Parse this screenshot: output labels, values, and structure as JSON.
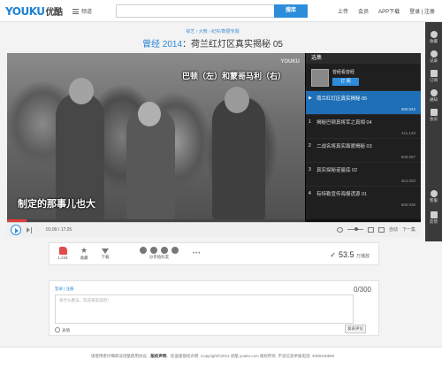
{
  "header": {
    "logo_en": "YOUKU",
    "logo_cn": "优酷",
    "channel_label": "频道",
    "search_value": "",
    "search_button": "搜库",
    "links": [
      "上传",
      "会员",
      "APP下载",
      "登录 | 注册"
    ]
  },
  "sidebar": {
    "items": [
      "收藏",
      "记录",
      "订阅",
      "通知",
      "会员",
      "客服",
      "反馈"
    ]
  },
  "video": {
    "breadcrumb": "综艺 › 大熊 › 纪实/数据专题",
    "series": "曾经 2014",
    "episode_title": "：荷兰红灯区真实揭秘 05",
    "caption_top": "巴顿（左）和蒙哥马利（右）",
    "caption_bottom": "制定的那事儿也大",
    "watermark": "YOUKU"
  },
  "playlist": {
    "tab_label": "选集",
    "uploader_name": "曾经看曾经",
    "subscribe_label": "订 阅",
    "episodes": [
      {
        "mark": "▶",
        "title": "荷兰红灯区真实揭秘 05",
        "views": "490,542",
        "active": true
      },
      {
        "mark": "1",
        "title": "揭秘巴顿真将军之真相 04",
        "views": "411,140",
        "active": false
      },
      {
        "mark": "2",
        "title": "二战名将真实面貌揭秘 03",
        "views": "608,657",
        "active": false
      },
      {
        "mark": "3",
        "title": "真实探秘诺曼底 02",
        "views": "354,003",
        "active": false
      },
      {
        "mark": "4",
        "title": "有特勒宣传海报谎源 01",
        "views": "659,938",
        "active": false
      }
    ]
  },
  "controls": {
    "current_time": "01:09",
    "total_time": "17:25",
    "time_sep": " / ",
    "progress": 0.066,
    "right_label": "自动",
    "next_label": "下一集"
  },
  "actions": {
    "like_count": "1,234",
    "favorite_label": "收藏",
    "download_label": "下载",
    "share_label": "分享给好友",
    "more": "•••",
    "plays_check": "✓",
    "plays_value": "53.5",
    "plays_unit": "万播放"
  },
  "comment": {
    "login_text": "登录 | 注册",
    "char_count": "0/300",
    "placeholder": "有什么看法，欢迎来说说吧！",
    "emoji_label": "表情",
    "post_button": "发表评论"
  },
  "footer": {
    "prefix": "请使用者仔细阅读优酷使用协议、",
    "bold1": "版权声明",
    "middle": "、反盗版侵权声明",
    "copyright": "Copyright©2014 优酷 youku.com 版权所有",
    "hotline": "不良信息举报电话: 4008100580"
  },
  "colors": {
    "brand_blue": "#2e8ddb",
    "accent_red": "#e33a3a",
    "sidebar_bg": "#3a3a3a",
    "playlist_active": "#1e6fb5"
  }
}
